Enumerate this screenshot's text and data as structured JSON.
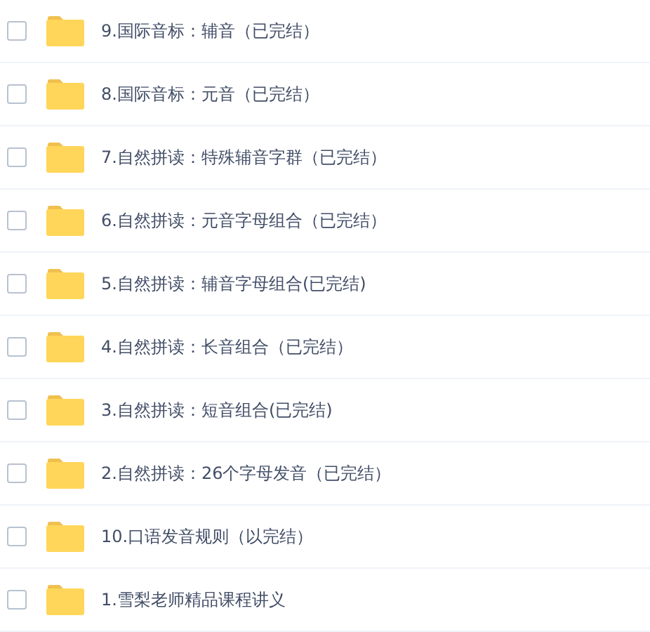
{
  "files": [
    {
      "name": "9.国际音标：辅音（已完结）",
      "checked": false
    },
    {
      "name": "8.国际音标：元音（已完结）",
      "checked": false
    },
    {
      "name": "7.自然拼读：特殊辅音字群（已完结）",
      "checked": false
    },
    {
      "name": "6.自然拼读：元音字母组合（已完结）",
      "checked": false
    },
    {
      "name": "5.自然拼读：辅音字母组合(已完结)",
      "checked": false
    },
    {
      "name": "4.自然拼读：长音组合（已完结）",
      "checked": false
    },
    {
      "name": "3.自然拼读：短音组合(已完结)",
      "checked": false
    },
    {
      "name": "2.自然拼读：26个字母发音（已完结）",
      "checked": false
    },
    {
      "name": "10.口语发音规则（以完结）",
      "checked": false
    },
    {
      "name": "1.雪梨老师精品课程讲义",
      "checked": false
    }
  ]
}
